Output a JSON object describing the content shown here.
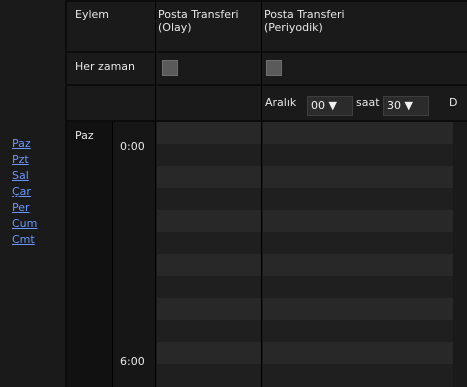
{
  "header": {
    "eylem": "Eylem",
    "col1": "Posta Transferi (Olay)",
    "col2": "Posta Transferi (Periyodik)"
  },
  "row_herzaman": {
    "label": "Her zaman"
  },
  "interval": {
    "aralik_label": "Aralık",
    "aralik_value": "00 ▼",
    "saat_label": "saat",
    "saat_value": "30 ▼",
    "d_label": "D"
  },
  "days": [
    "Paz",
    "Pzt",
    "Sal",
    "Çar",
    "Per",
    "Cum",
    "Cmt"
  ],
  "schedule": {
    "day": "Paz",
    "time_start": "0:00",
    "time_end": "6:00"
  }
}
